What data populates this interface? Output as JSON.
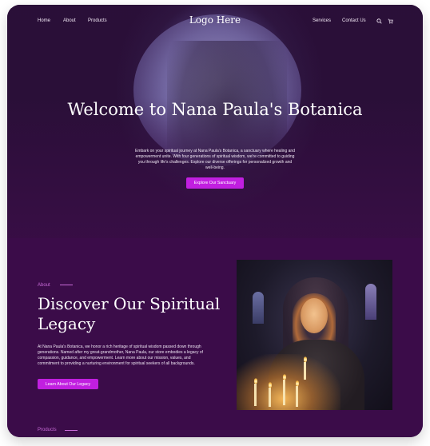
{
  "nav": {
    "left_links": [
      "Home",
      "About",
      "Products"
    ],
    "logo": "Logo Here",
    "right_links": [
      "Services",
      "Contact Us"
    ],
    "icons": [
      "search-icon",
      "cart-icon"
    ]
  },
  "hero": {
    "title": "Welcome to Nana Paula's Botanica",
    "description": "Embark on your spiritual journey at Nana Paula's Botanica, a sanctuary where healing and empowerment unite. With four generations of spiritual wisdom, we're committed to guiding you through life's challenges. Explore our diverse offerings for personalized growth and well-being.",
    "button_label": "Explore Our Sanctuary"
  },
  "about": {
    "eyebrow": "About",
    "title": "Discover Our Spiritual Legacy",
    "description": "At Nana Paula's Botanica, we honor a rich heritage of spiritual wisdom passed down through generations. Named after my great-grandmother, Nana Paula, our store embodies a legacy of compassion, guidance, and empowerment. Learn more about our mission, values, and commitment to providing a nurturing environment for spiritual seekers of all backgrounds.",
    "button_label": "Learn About Our Legacy"
  },
  "next_section": {
    "eyebrow": "Products"
  },
  "colors": {
    "accent": "#c11fe0",
    "background": "#3b0c49",
    "eyebrow": "#c86ad8"
  }
}
